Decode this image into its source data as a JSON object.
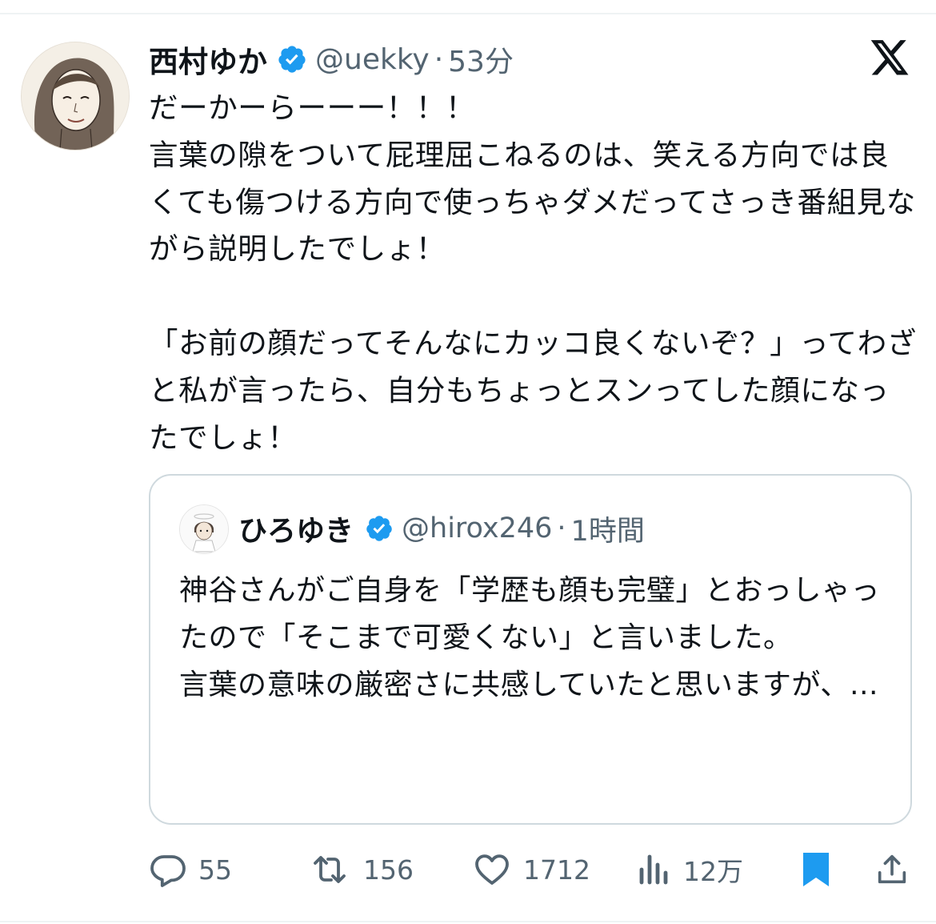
{
  "tweet": {
    "display_name": "西村ゆか",
    "handle": "@uekky",
    "separator": "·",
    "time": "53分",
    "text": "だーかーらーーー！！！\n言葉の隙をついて屁理屈こねるのは、笑える方向では良くても傷つける方向で使っちゃダメだってさっき番組見ながら説明したでしょ！\n\n「お前の顔だってそんなにカッコ良くないぞ？」ってわざと私が言ったら、自分もちょっとスンってした顔になったでしょ！"
  },
  "quote": {
    "display_name": "ひろゆき",
    "handle": "@hirox246",
    "separator": "·",
    "time": "1時間",
    "text": "神谷さんがご自身を「学歴も顔も完璧」とおっしゃったので「そこまで可愛くない」と言いました。\n言葉の意味の厳密さに共感していたと思いますが、…"
  },
  "actions": {
    "replies": "55",
    "reposts": "156",
    "likes": "1712",
    "views": "12万"
  },
  "colors": {
    "verified": "#1d9bf0",
    "bookmark": "#1d9bf0",
    "secondary_text": "#536471",
    "border": "#cfd9de"
  },
  "icons": [
    "x-logo-icon",
    "verified-badge-icon",
    "reply-icon",
    "repost-icon",
    "like-icon",
    "views-icon",
    "bookmark-icon",
    "share-icon"
  ]
}
